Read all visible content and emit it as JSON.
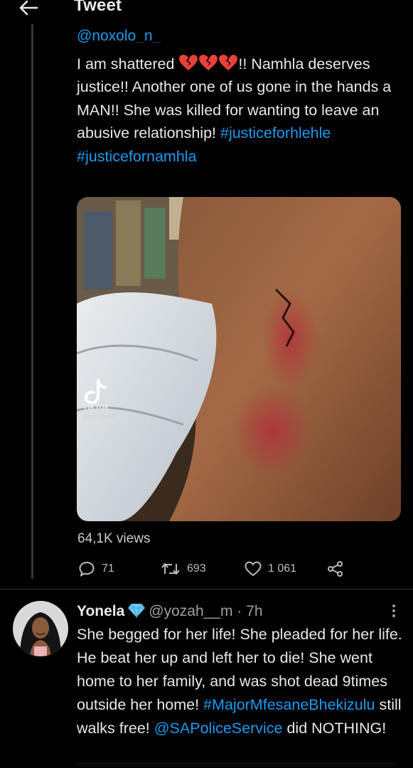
{
  "header": {
    "title": "Tweet",
    "back_icon": "arrow-left-icon"
  },
  "tweet": {
    "handle": "@noxolo_n_",
    "text_part1": "I am shattered ",
    "text_part2": "!! Namhla deserves justice!! Another one of us gone in the hands a MAN!! She was killed for wanting to leave an abusive relationship! ",
    "hashtag1": "#justiceforhlehle",
    "hashtag2": "#justicefornamhla",
    "emoji": "broken-heart-icon",
    "media": {
      "watermark_brand": "TikTok",
      "watermark_user": "@dendiho11"
    },
    "views": "64,1K views",
    "replies_count": "71",
    "retweets_count": "693",
    "likes_count": "1 061",
    "share_icon": "share-icon"
  },
  "reply": {
    "name": "Yonela",
    "handle": "@yozah__m",
    "separator": " · ",
    "time": "7h",
    "text_part1": "She begged for her life! She pleaded for her life. He beat her up and left her to die! She went home to her family, and was shot dead 9times outside her home! ",
    "hashtag": "#MajorMfesaneBhekizulu",
    "text_part2": " still walks free! ",
    "mention": "@SAPoliceService",
    "text_part3": " did NOTHING!"
  },
  "colors": {
    "background": "#000000",
    "text": "#e7e9ea",
    "link": "#1d9bf0",
    "muted": "#9aa0a6",
    "divider": "#2f3336"
  }
}
